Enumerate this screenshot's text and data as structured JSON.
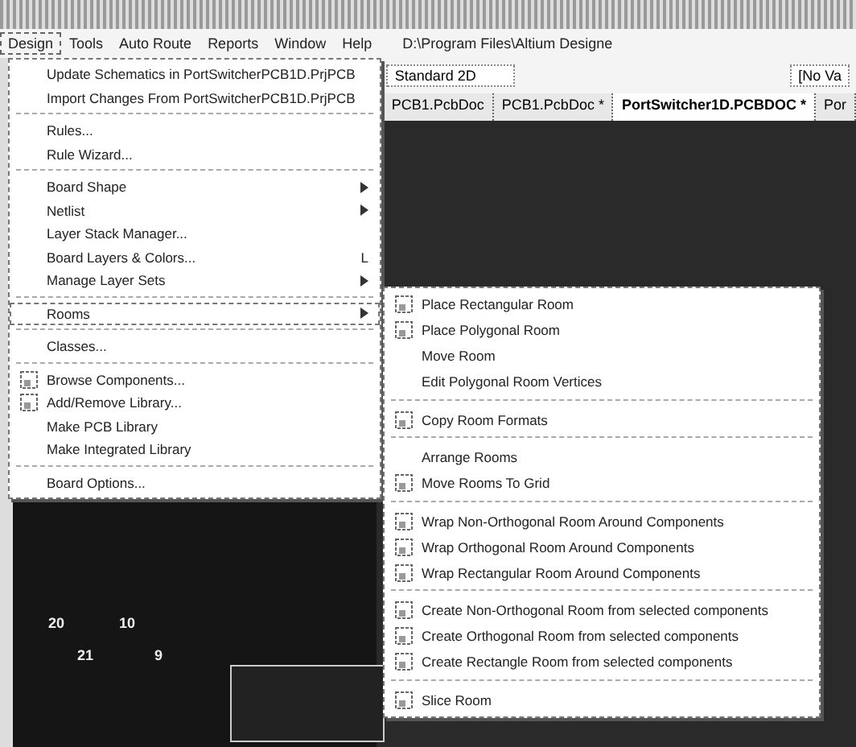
{
  "menu_bar": {
    "items": [
      {
        "label": "Design",
        "selected": true
      },
      {
        "label": "Tools",
        "selected": false
      },
      {
        "label": "Auto Route",
        "selected": false
      },
      {
        "label": "Reports",
        "selected": false
      },
      {
        "label": "Window",
        "selected": false
      },
      {
        "label": "Help",
        "selected": false
      }
    ],
    "path": "D:\\Program Files\\Altium Designe"
  },
  "toolbar": {
    "view_select": "Standard 2D",
    "filter": "[No Va"
  },
  "document_tabs": [
    {
      "label": "PCB1.PcbDoc",
      "selected": false
    },
    {
      "label": "PCB1.PcbDoc *",
      "selected": false
    },
    {
      "label": "PortSwitcher1D.PCBDOC *",
      "selected": true
    },
    {
      "label": "Por",
      "selected": false
    }
  ],
  "design_menu": [
    {
      "kind": "item",
      "label": "Update Schematics in PortSwitcherPCB1D.PrjPCB",
      "icon": false,
      "submenu": false,
      "selected": false
    },
    {
      "kind": "item",
      "label": "Import Changes From PortSwitcherPCB1D.PrjPCB",
      "icon": false,
      "submenu": false,
      "selected": false
    },
    {
      "kind": "separator"
    },
    {
      "kind": "item",
      "label": "Rules...",
      "icon": false,
      "submenu": false,
      "selected": false
    },
    {
      "kind": "item",
      "label": "Rule Wizard...",
      "icon": false,
      "submenu": false,
      "selected": false
    },
    {
      "kind": "separator"
    },
    {
      "kind": "item",
      "label": "Board Shape",
      "icon": false,
      "submenu": true,
      "selected": false
    },
    {
      "kind": "item",
      "label": "Netlist",
      "icon": false,
      "submenu": true,
      "selected": false
    },
    {
      "kind": "item",
      "label": "Layer Stack Manager...",
      "icon": false,
      "submenu": false,
      "selected": false
    },
    {
      "kind": "item",
      "label": "Board Layers & Colors...",
      "icon": false,
      "submenu": false,
      "selected": false,
      "shortcut": "L"
    },
    {
      "kind": "item",
      "label": "Manage Layer Sets",
      "icon": false,
      "submenu": true,
      "selected": false
    },
    {
      "kind": "separator"
    },
    {
      "kind": "item",
      "label": "Rooms",
      "icon": false,
      "submenu": true,
      "selected": true
    },
    {
      "kind": "separator"
    },
    {
      "kind": "item",
      "label": "Classes...",
      "icon": false,
      "submenu": false,
      "selected": false
    },
    {
      "kind": "separator"
    },
    {
      "kind": "item",
      "label": "Browse Components...",
      "icon": true,
      "submenu": false,
      "selected": false
    },
    {
      "kind": "item",
      "label": "Add/Remove Library...",
      "icon": true,
      "submenu": false,
      "selected": false
    },
    {
      "kind": "item",
      "label": "Make PCB Library",
      "icon": false,
      "submenu": false,
      "selected": false
    },
    {
      "kind": "item",
      "label": "Make Integrated Library",
      "icon": false,
      "submenu": false,
      "selected": false
    },
    {
      "kind": "separator"
    },
    {
      "kind": "item",
      "label": "Board Options...",
      "icon": false,
      "submenu": false,
      "selected": false
    }
  ],
  "rooms_menu": [
    {
      "kind": "item",
      "label": "Place Rectangular Room",
      "icon": true
    },
    {
      "kind": "item",
      "label": "Place Polygonal Room",
      "icon": true
    },
    {
      "kind": "item",
      "label": "Move Room",
      "icon": false
    },
    {
      "kind": "item",
      "label": "Edit Polygonal Room Vertices",
      "icon": false
    },
    {
      "kind": "separator"
    },
    {
      "kind": "item",
      "label": "Copy Room Formats",
      "icon": true
    },
    {
      "kind": "separator"
    },
    {
      "kind": "item",
      "label": "Arrange Rooms",
      "icon": false
    },
    {
      "kind": "item",
      "label": "Move Rooms To Grid",
      "icon": true
    },
    {
      "kind": "separator"
    },
    {
      "kind": "item",
      "label": "Wrap Non-Orthogonal Room Around Components",
      "icon": true
    },
    {
      "kind": "item",
      "label": "Wrap Orthogonal Room Around Components",
      "icon": true
    },
    {
      "kind": "item",
      "label": "Wrap Rectangular Room Around Components",
      "icon": true
    },
    {
      "kind": "separator"
    },
    {
      "kind": "item",
      "label": "Create Non-Orthogonal Room from selected components",
      "icon": true
    },
    {
      "kind": "item",
      "label": "Create Orthogonal Room from selected components",
      "icon": true
    },
    {
      "kind": "item",
      "label": "Create Rectangle Room from selected components",
      "icon": true
    },
    {
      "kind": "separator"
    },
    {
      "kind": "item",
      "label": "Slice Room",
      "icon": true
    }
  ],
  "canvas_labels": [
    "20",
    "10",
    "21",
    "9"
  ]
}
